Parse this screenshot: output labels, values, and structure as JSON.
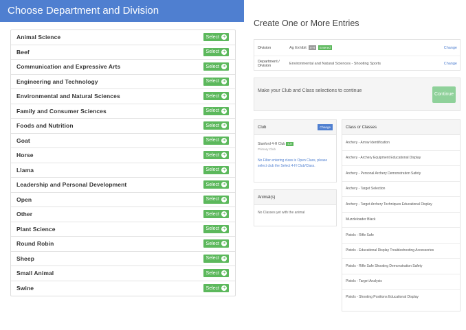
{
  "left": {
    "header": "Choose Department and Division",
    "select_label": "Select",
    "departments": [
      "Animal Science",
      "Beef",
      "Communication and Expressive Arts",
      "Engineering and Technology",
      "Environmental and Natural Sciences",
      "Family and Consumer Sciences",
      "Foods and Nutrition",
      "Goat",
      "Horse",
      "Llama",
      "Leadership and Personal Development",
      "Open",
      "Other",
      "Plant Science",
      "Round Robin",
      "Sheep",
      "Small Animal",
      "Swine"
    ]
  },
  "right": {
    "title": "Create One or More Entries",
    "division": {
      "label": "Division",
      "value": "Ag Exhibit",
      "tag_gray": "4-H",
      "tag_green": "Entered",
      "change": "Change"
    },
    "department": {
      "label": "Department / Division",
      "value": "Environmental and Natural Sciences - Shooting Sports",
      "change": "Change"
    },
    "continue_text": "Make your Club and Class selections to continue",
    "continue_button": "Continue",
    "club": {
      "title": "Club",
      "change_button": "Change",
      "line1": "Stanford 4-H Club",
      "tag": "4-H",
      "line2": "Primary Club",
      "note": "No Filter entering class is Open Class, please select club the Select 4-H Club/Class."
    },
    "animals": {
      "title": "Animal(s)",
      "text": "No Classes yet with the animal"
    },
    "classes": {
      "title": "Class or Classes",
      "items": [
        "Archery - Arrow Identification",
        "Archery - Archery Equipment Educational Display",
        "Archery - Personal Archery Demonstration Safety",
        "Archery - Target Selection",
        "Archery - Target Archery Techniques Educational Display",
        "Muzzleloader Black",
        "Pistols - Rifle Safe",
        "Pistols - Educational Display Troubleshooting Accessories",
        "Pistols - Rifle Safe Shooting Demonstration Safety",
        "Pistols - Target Analysis",
        "Pistols - Shooting Positions Educational Display"
      ]
    }
  }
}
